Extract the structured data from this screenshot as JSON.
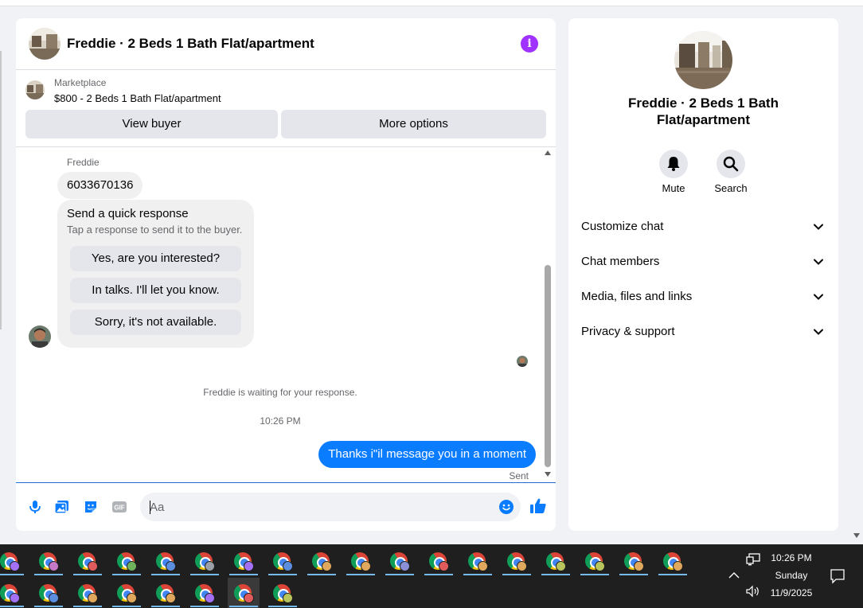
{
  "chat_header": {
    "title": "Freddie · 2 Beds 1 Bath Flat/apartment"
  },
  "marketplace": {
    "label": "Marketplace",
    "listing": "$800 - 2 Beds 1 Bath Flat/apartment",
    "view_buyer": "View buyer",
    "more_options": "More options"
  },
  "messages": {
    "sender_name": "Freddie",
    "phone": "6033670136",
    "quick_title": "Send a quick response",
    "quick_sub": "Tap a response to send it to the buyer.",
    "quick_options": [
      "Yes, are you interested?",
      "In talks. I'll let you know.",
      "Sorry, it's not available."
    ],
    "waiting": "Freddie is waiting for your response.",
    "time": "10:26 PM",
    "my_message": "Thanks i\"il message you in a moment",
    "status": "Sent"
  },
  "composer": {
    "placeholder": "Aa"
  },
  "info_panel": {
    "title": "Freddie · 2 Beds 1 Bath Flat/apartment",
    "mute_label": "Mute",
    "search_label": "Search",
    "sections": [
      "Customize chat",
      "Chat members",
      "Media, files and links",
      "Privacy & support"
    ]
  },
  "taskbar": {
    "time": "10:26 PM",
    "day": "Sunday",
    "date": "11/9/2025",
    "row1_profile_colors": [
      "#a371f7",
      "#c679c6",
      "#e05c5c",
      "#6fb35c",
      "#5c8ee0",
      "#9aa0a6",
      "#a371f7",
      "#5c8ee0",
      "#e0a85c",
      "#e0a85c",
      "#8b8fd6",
      "#e05c5c",
      "#e0a85c",
      "#e0a85c",
      "#b8c45c",
      "#b8c45c",
      "#e0a85c",
      "#e0a85c"
    ],
    "row2_profile_colors": [
      "#a371f7",
      "#5c8ee0",
      "#e0a85c",
      "#e0a85c",
      "#e0a85c",
      "#a371f7",
      "#e05c5c",
      "#b8c45c"
    ],
    "colors": {
      "active_underline": "#76b9ed",
      "bg": "#1f1f1f"
    }
  },
  "colors": {
    "accent_blue": "#0a7cff",
    "info_purple": "#a033ff",
    "bubble_gray": "#f0f0f0"
  }
}
